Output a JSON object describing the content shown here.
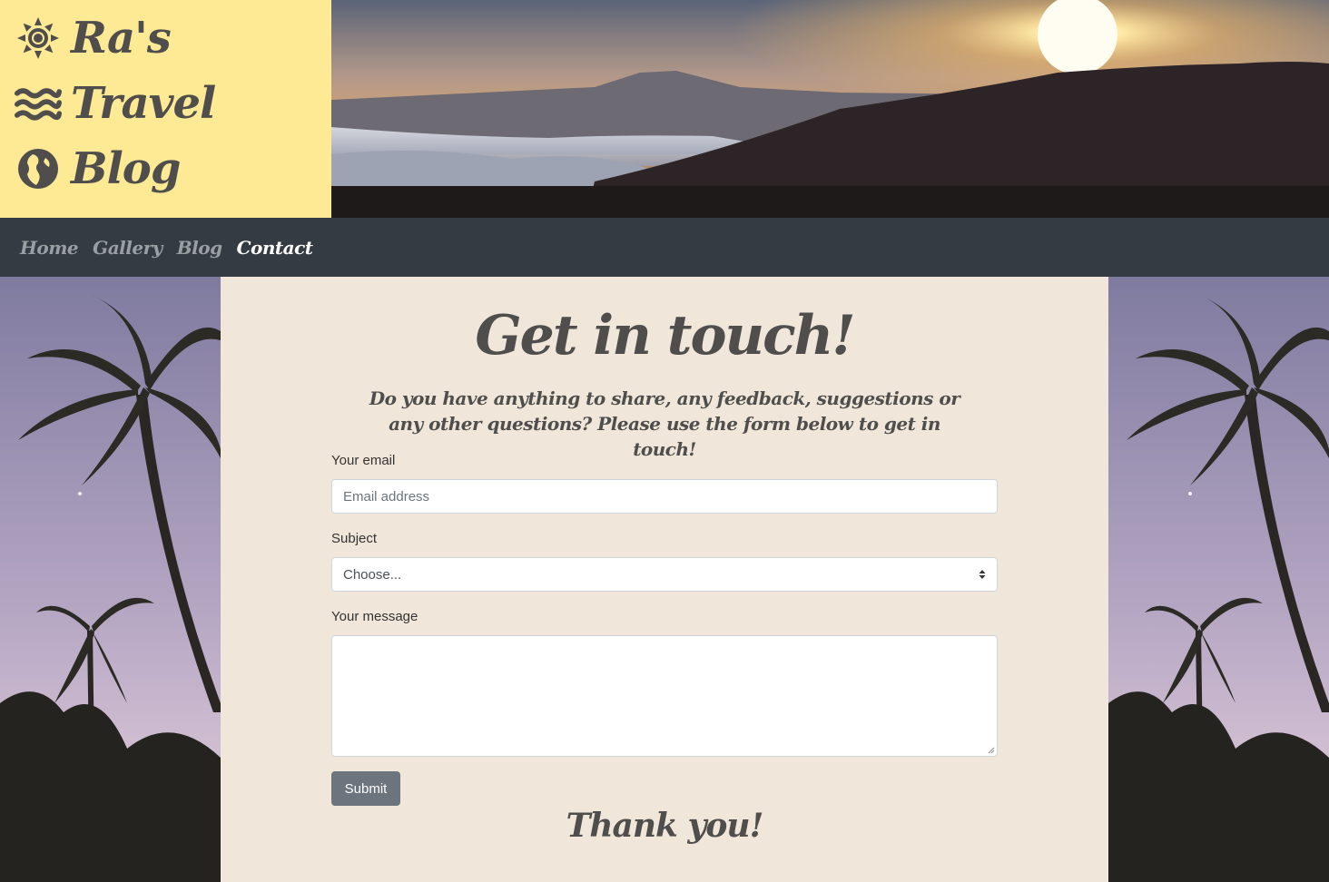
{
  "logo": {
    "lines": [
      {
        "icon": "sun-icon",
        "text": "Ra's"
      },
      {
        "icon": "waves-icon",
        "text": "Travel"
      },
      {
        "icon": "globe-icon",
        "text": "Blog"
      }
    ]
  },
  "banner": {
    "image": "mountain-sunset-photo"
  },
  "nav": {
    "items": [
      {
        "label": "Home",
        "active": false
      },
      {
        "label": "Gallery",
        "active": false
      },
      {
        "label": "Blog",
        "active": false
      },
      {
        "label": "Contact",
        "active": true
      }
    ]
  },
  "main": {
    "title": "Get in touch!",
    "subtitle": "Do you have anything to share, any feedback, suggestions or any other questions? Please use the form below to get in touch!",
    "form": {
      "email_label": "Your email",
      "email_placeholder": "Email address",
      "email_value": "",
      "subject_label": "Subject",
      "subject_selected": "Choose...",
      "message_label": "Your message",
      "message_value": "",
      "submit_label": "Submit"
    },
    "thanks": "Thank you!"
  },
  "background": {
    "image": "palm-trees-twilight-photo"
  },
  "colors": {
    "logo_bg": "#fee994",
    "nav_bg": "#353b42",
    "content_bg": "#f0e7da",
    "heading_text": "#4f4e4d",
    "button_bg": "#6c757d"
  }
}
